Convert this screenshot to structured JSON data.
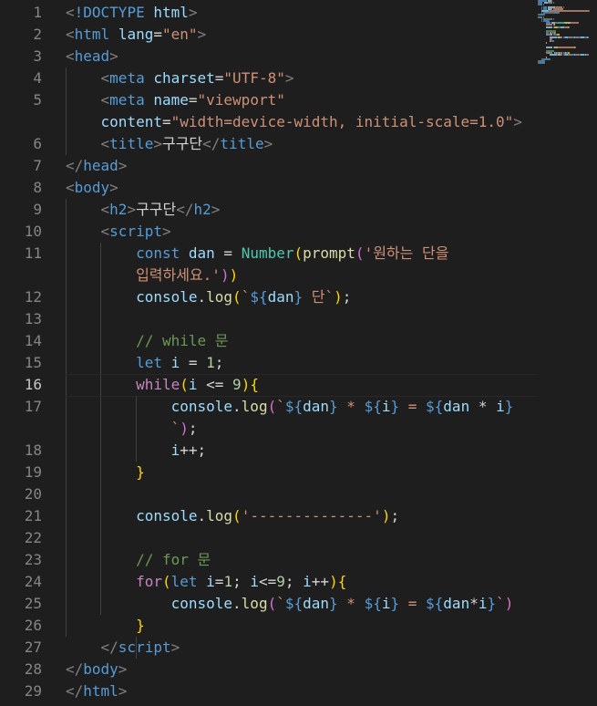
{
  "editor": {
    "lines": [
      {
        "n": "1",
        "tokens": [
          [
            "punc",
            "<"
          ],
          [
            "tag",
            "!DOCTYPE"
          ],
          [
            "txt",
            " "
          ],
          [
            "attr",
            "html"
          ],
          [
            "punc",
            ">"
          ]
        ]
      },
      {
        "n": "2",
        "tokens": [
          [
            "punc",
            "<"
          ],
          [
            "tag",
            "html"
          ],
          [
            "txt",
            " "
          ],
          [
            "attr",
            "lang"
          ],
          [
            "txt",
            "="
          ],
          [
            "str",
            "\"en\""
          ],
          [
            "punc",
            ">"
          ]
        ]
      },
      {
        "n": "3",
        "tokens": [
          [
            "punc",
            "<"
          ],
          [
            "tag",
            "head"
          ],
          [
            "punc",
            ">"
          ]
        ]
      },
      {
        "n": "4",
        "tokens": [
          [
            "txt",
            "    "
          ],
          [
            "punc",
            "<"
          ],
          [
            "tag",
            "meta"
          ],
          [
            "txt",
            " "
          ],
          [
            "attr",
            "charset"
          ],
          [
            "txt",
            "="
          ],
          [
            "str",
            "\"UTF-8\""
          ],
          [
            "punc",
            ">"
          ]
        ]
      },
      {
        "n": "5",
        "tokens": [
          [
            "txt",
            "    "
          ],
          [
            "punc",
            "<"
          ],
          [
            "tag",
            "meta"
          ],
          [
            "txt",
            " "
          ],
          [
            "attr",
            "name"
          ],
          [
            "txt",
            "="
          ],
          [
            "str",
            "\"viewport\""
          ]
        ]
      },
      {
        "n": "",
        "tokens": [
          [
            "txt",
            "    "
          ],
          [
            "attr",
            "content"
          ],
          [
            "txt",
            "="
          ],
          [
            "str",
            "\"width=device-width, initial-scale=1.0\""
          ],
          [
            "punc",
            ">"
          ]
        ]
      },
      {
        "n": "6",
        "tokens": [
          [
            "txt",
            "    "
          ],
          [
            "punc",
            "<"
          ],
          [
            "tag",
            "title"
          ],
          [
            "punc",
            ">"
          ],
          [
            "txt",
            "구구단"
          ],
          [
            "punc",
            "</"
          ],
          [
            "tag",
            "title"
          ],
          [
            "punc",
            ">"
          ]
        ]
      },
      {
        "n": "7",
        "tokens": [
          [
            "punc",
            "</"
          ],
          [
            "tag",
            "head"
          ],
          [
            "punc",
            ">"
          ]
        ]
      },
      {
        "n": "8",
        "tokens": [
          [
            "punc",
            "<"
          ],
          [
            "tag",
            "body"
          ],
          [
            "punc",
            ">"
          ]
        ]
      },
      {
        "n": "9",
        "tokens": [
          [
            "txt",
            "    "
          ],
          [
            "punc",
            "<"
          ],
          [
            "tag",
            "h2"
          ],
          [
            "punc",
            ">"
          ],
          [
            "txt",
            "구구단"
          ],
          [
            "punc",
            "</"
          ],
          [
            "tag",
            "h2"
          ],
          [
            "punc",
            ">"
          ]
        ]
      },
      {
        "n": "10",
        "tokens": [
          [
            "txt",
            "    "
          ],
          [
            "punc",
            "<"
          ],
          [
            "tag",
            "script"
          ],
          [
            "punc",
            ">"
          ]
        ]
      },
      {
        "n": "11",
        "tokens": [
          [
            "txt",
            "        "
          ],
          [
            "kw",
            "const"
          ],
          [
            "txt",
            " "
          ],
          [
            "var",
            "dan"
          ],
          [
            "txt",
            " = "
          ],
          [
            "cls",
            "Number"
          ],
          [
            "b1",
            "("
          ],
          [
            "fn",
            "prompt"
          ],
          [
            "b2",
            "("
          ],
          [
            "str",
            "'원하는 단을"
          ]
        ]
      },
      {
        "n": "",
        "tokens": [
          [
            "txt",
            "        "
          ],
          [
            "str",
            "입력하세요.'"
          ],
          [
            "b2",
            ")"
          ],
          [
            "b1",
            ")"
          ]
        ]
      },
      {
        "n": "12",
        "tokens": [
          [
            "txt",
            "        "
          ],
          [
            "var",
            "console"
          ],
          [
            "txt",
            "."
          ],
          [
            "fn",
            "log"
          ],
          [
            "b1",
            "("
          ],
          [
            "str",
            "`"
          ],
          [
            "kw",
            "${"
          ],
          [
            "var",
            "dan"
          ],
          [
            "kw",
            "}"
          ],
          [
            "str",
            " 단`"
          ],
          [
            "b1",
            ")"
          ],
          [
            "txt",
            ";"
          ]
        ]
      },
      {
        "n": "13",
        "tokens": []
      },
      {
        "n": "14",
        "tokens": [
          [
            "txt",
            "        "
          ],
          [
            "cmt",
            "// while 문"
          ]
        ]
      },
      {
        "n": "15",
        "tokens": [
          [
            "txt",
            "        "
          ],
          [
            "kw",
            "let"
          ],
          [
            "txt",
            " "
          ],
          [
            "var",
            "i"
          ],
          [
            "txt",
            " = "
          ],
          [
            "num",
            "1"
          ],
          [
            "txt",
            ";"
          ]
        ]
      },
      {
        "n": "16",
        "active": true,
        "tokens": [
          [
            "txt",
            "        "
          ],
          [
            "ctl",
            "while"
          ],
          [
            "b1",
            "("
          ],
          [
            "var",
            "i"
          ],
          [
            "txt",
            " <= "
          ],
          [
            "num",
            "9"
          ],
          [
            "b1",
            ")"
          ],
          [
            "b1",
            "{"
          ]
        ]
      },
      {
        "n": "17",
        "tokens": [
          [
            "txt",
            "            "
          ],
          [
            "var",
            "console"
          ],
          [
            "txt",
            "."
          ],
          [
            "fn",
            "log"
          ],
          [
            "b2",
            "("
          ],
          [
            "str",
            "`"
          ],
          [
            "kw",
            "${"
          ],
          [
            "var",
            "dan"
          ],
          [
            "kw",
            "}"
          ],
          [
            "str",
            " * "
          ],
          [
            "kw",
            "${"
          ],
          [
            "var",
            "i"
          ],
          [
            "kw",
            "}"
          ],
          [
            "str",
            " = "
          ],
          [
            "kw",
            "${"
          ],
          [
            "var",
            "dan"
          ],
          [
            "txt",
            " * "
          ],
          [
            "var",
            "i"
          ],
          [
            "kw",
            "}"
          ]
        ]
      },
      {
        "n": "",
        "tokens": [
          [
            "txt",
            "            "
          ],
          [
            "str",
            "`"
          ],
          [
            "b2",
            ")"
          ],
          [
            "txt",
            ";"
          ]
        ]
      },
      {
        "n": "18",
        "tokens": [
          [
            "txt",
            "            "
          ],
          [
            "var",
            "i"
          ],
          [
            "txt",
            "++;"
          ]
        ]
      },
      {
        "n": "19",
        "tokens": [
          [
            "txt",
            "        "
          ],
          [
            "b1",
            "}"
          ]
        ]
      },
      {
        "n": "20",
        "tokens": []
      },
      {
        "n": "21",
        "tokens": [
          [
            "txt",
            "        "
          ],
          [
            "var",
            "console"
          ],
          [
            "txt",
            "."
          ],
          [
            "fn",
            "log"
          ],
          [
            "b1",
            "("
          ],
          [
            "str",
            "'--------------'"
          ],
          [
            "b1",
            ")"
          ],
          [
            "txt",
            ";"
          ]
        ]
      },
      {
        "n": "22",
        "tokens": []
      },
      {
        "n": "23",
        "tokens": [
          [
            "txt",
            "        "
          ],
          [
            "cmt",
            "// for 문"
          ]
        ]
      },
      {
        "n": "24",
        "tokens": [
          [
            "txt",
            "        "
          ],
          [
            "ctl",
            "for"
          ],
          [
            "b1",
            "("
          ],
          [
            "kw",
            "let"
          ],
          [
            "txt",
            " "
          ],
          [
            "var",
            "i"
          ],
          [
            "txt",
            "="
          ],
          [
            "num",
            "1"
          ],
          [
            "txt",
            "; "
          ],
          [
            "var",
            "i"
          ],
          [
            "txt",
            "<="
          ],
          [
            "num",
            "9"
          ],
          [
            "txt",
            "; "
          ],
          [
            "var",
            "i"
          ],
          [
            "txt",
            "++"
          ],
          [
            "b1",
            ")"
          ],
          [
            "b1",
            "{"
          ]
        ]
      },
      {
        "n": "25",
        "tokens": [
          [
            "txt",
            "            "
          ],
          [
            "var",
            "console"
          ],
          [
            "txt",
            "."
          ],
          [
            "fn",
            "log"
          ],
          [
            "b2",
            "("
          ],
          [
            "str",
            "`"
          ],
          [
            "kw",
            "${"
          ],
          [
            "var",
            "dan"
          ],
          [
            "kw",
            "}"
          ],
          [
            "str",
            " * "
          ],
          [
            "kw",
            "${"
          ],
          [
            "var",
            "i"
          ],
          [
            "kw",
            "}"
          ],
          [
            "str",
            " = "
          ],
          [
            "kw",
            "${"
          ],
          [
            "var",
            "dan"
          ],
          [
            "txt",
            "*"
          ],
          [
            "var",
            "i"
          ],
          [
            "kw",
            "}"
          ],
          [
            "str",
            "`"
          ],
          [
            "b2",
            ")"
          ]
        ]
      },
      {
        "n": "26",
        "tokens": [
          [
            "txt",
            "        "
          ],
          [
            "b1",
            "}"
          ]
        ]
      },
      {
        "n": "27",
        "tokens": [
          [
            "txt",
            "    "
          ],
          [
            "punc",
            "</"
          ],
          [
            "tag",
            "script"
          ],
          [
            "punc",
            ">"
          ]
        ]
      },
      {
        "n": "28",
        "tokens": [
          [
            "punc",
            "</"
          ],
          [
            "tag",
            "body"
          ],
          [
            "punc",
            ">"
          ]
        ]
      },
      {
        "n": "29",
        "tokens": [
          [
            "punc",
            "</"
          ],
          [
            "tag",
            "html"
          ],
          [
            "punc",
            ">"
          ]
        ]
      }
    ]
  },
  "colors": {
    "background": "#1e1e1e",
    "line_number": "#858585",
    "line_number_active": "#c6c6c6",
    "tag": "#569cd6",
    "attribute": "#9cdcfe",
    "string": "#ce9178",
    "control_keyword": "#c586c0",
    "function": "#dcdcaa",
    "class": "#4ec9b0",
    "number": "#b5cea8",
    "comment": "#6a9955",
    "bracket_1": "#ffd700",
    "bracket_2": "#da70d6"
  }
}
